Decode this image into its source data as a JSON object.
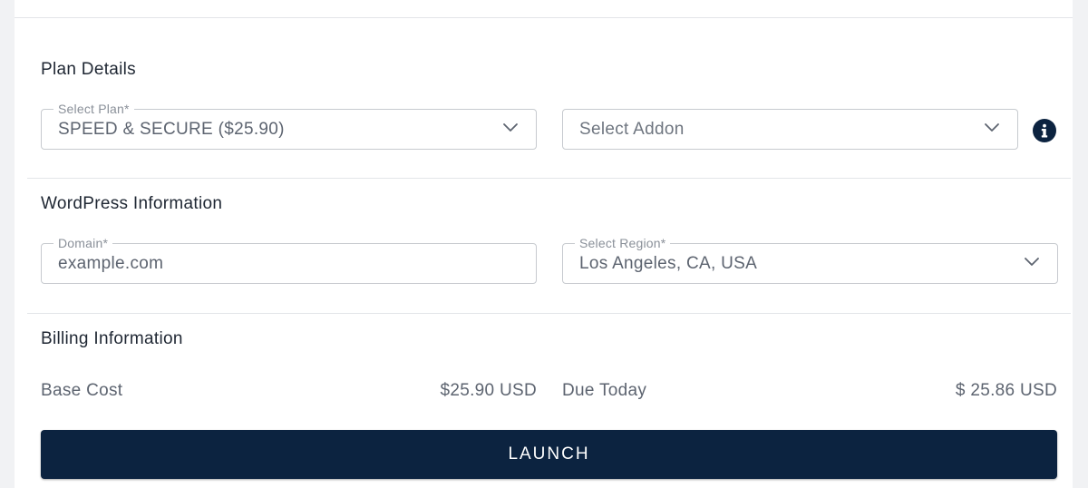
{
  "plan_details": {
    "title": "Plan Details",
    "plan_select": {
      "label": "Select Plan*",
      "value": "SPEED & SECURE ($25.90)"
    },
    "addon_select": {
      "placeholder": "Select Addon"
    },
    "info_icon": "info-icon"
  },
  "wordpress_info": {
    "title": "WordPress Information",
    "domain": {
      "label": "Domain*",
      "value": "example.com"
    },
    "region_select": {
      "label": "Select Region*",
      "value": "Los Angeles, CA, USA"
    }
  },
  "billing": {
    "title": "Billing Information",
    "base_cost_label": "Base Cost",
    "base_cost_value": "$25.90 USD",
    "due_today_label": "Due Today",
    "due_today_value": "$ 25.86 USD"
  },
  "actions": {
    "launch_label": "LAUNCH"
  },
  "colors": {
    "primary": "#0c2340",
    "border": "#c7cacf",
    "text": "#1f2733",
    "muted_text": "#5d6470"
  }
}
